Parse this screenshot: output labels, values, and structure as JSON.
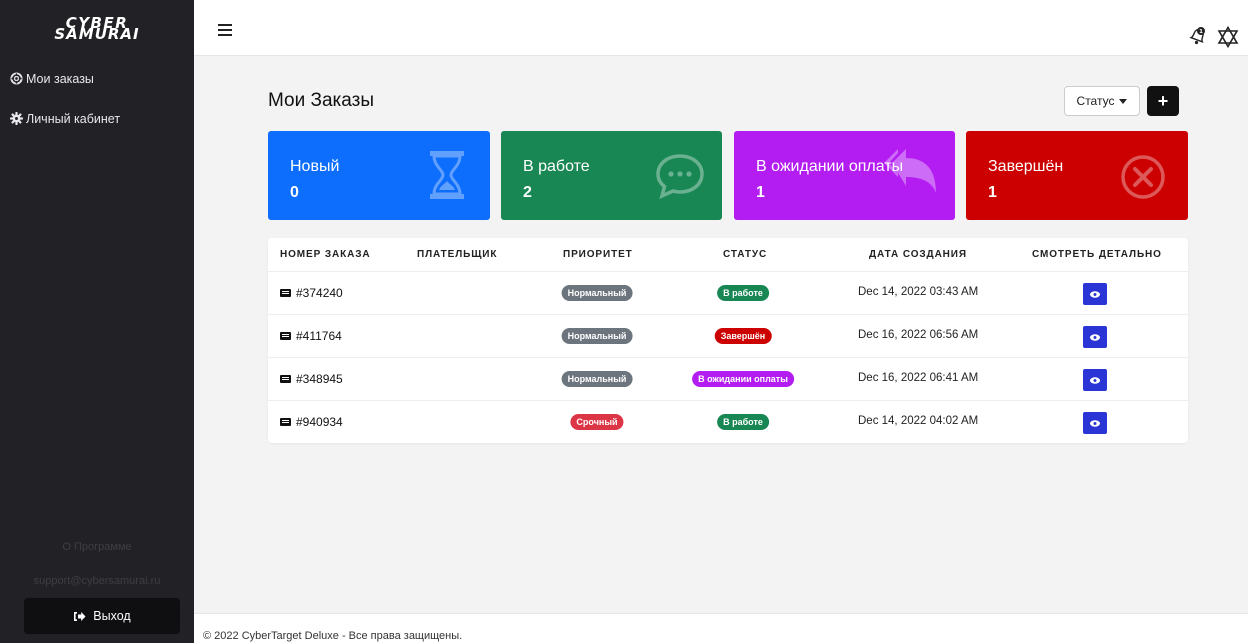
{
  "app": {
    "logo_line1": "CYBER",
    "logo_line2": "SAMURAI"
  },
  "sidebar": {
    "items": [
      {
        "label": "Мои заказы",
        "icon": "lifebuoy-icon"
      },
      {
        "label": "Личный кабинет",
        "icon": "gear-icon"
      }
    ],
    "about": "О Программе",
    "support_email": "support@cybersamurai.ru",
    "logout_label": "Выход",
    "logout_icon": "sign-out-icon"
  },
  "topbar": {
    "menu_icon": "hamburger-icon",
    "notifications_icon": "bell-icon",
    "settings_icon": "star-of-david-icon"
  },
  "main": {
    "title": "Мои Заказы",
    "status_filter_label": "Статус",
    "add_label": "+"
  },
  "cards": [
    {
      "label": "Новый",
      "count": "0",
      "color": "#0d6efd",
      "icon": "hourglass-icon"
    },
    {
      "label": "В работе",
      "count": "2",
      "color": "#198754",
      "icon": "chat-bubble-icon"
    },
    {
      "label": "В ожидании оплаты",
      "count": "1",
      "color": "#b31df2",
      "icon": "reply-all-icon"
    },
    {
      "label": "Завершён",
      "count": "1",
      "color": "#cc0000",
      "icon": "circle-x-icon"
    }
  ],
  "table": {
    "headers": [
      "НОМЕР ЗАКАЗА",
      "ПЛАТЕЛЬЩИК",
      "ПРИОРИТЕТ",
      "СТАТУС",
      "ДАТА СОЗДАНИЯ",
      "СМОТРЕТЬ ДЕТАЛЬНО"
    ],
    "rows": [
      {
        "id": "#374240",
        "payer": "",
        "priority": "Нормальный",
        "priority_color": "#6c757d",
        "status": "В работе",
        "status_color": "#198754",
        "date": "Dec 14, 2022 03:43 AM"
      },
      {
        "id": "#411764",
        "payer": "",
        "priority": "Нормальный",
        "priority_color": "#6c757d",
        "status": "Завершён",
        "status_color": "#cc0000",
        "date": "Dec 16, 2022 06:56 AM"
      },
      {
        "id": "#348945",
        "payer": "",
        "priority": "Нормальный",
        "priority_color": "#6c757d",
        "status": "В ожидании оплаты",
        "status_color": "#b31df2",
        "date": "Dec 16, 2022 06:41 AM"
      },
      {
        "id": "#940934",
        "payer": "",
        "priority": "Срочный",
        "priority_color": "#dc3545",
        "status": "В работе",
        "status_color": "#198754",
        "date": "Dec 14, 2022 04:02 AM"
      }
    ]
  },
  "footer": {
    "copyright": "© 2022 CyberTarget Deluxe - Все права защищены."
  }
}
